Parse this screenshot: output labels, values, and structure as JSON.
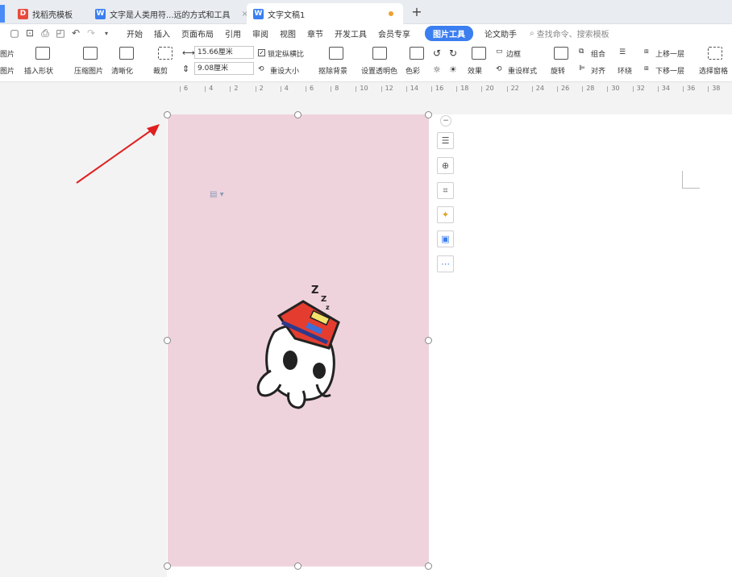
{
  "tabs": [
    {
      "label": "找稻壳模板",
      "color": "#e84a3c"
    },
    {
      "label": "文字是人类用符...远的方式和工具",
      "color": "#3b7ef0",
      "close": "×"
    },
    {
      "label": "文字文稿1",
      "color": "#3b7ef0"
    }
  ],
  "new_tab": "+",
  "menu": {
    "items": [
      "开始",
      "插入",
      "页面布局",
      "引用",
      "审阅",
      "视图",
      "章节",
      "开发工具",
      "会员专享"
    ],
    "active": "图片工具",
    "after": "论文助手",
    "search": "查找命令、搜索模板"
  },
  "ribbon": {
    "img_top": "图片",
    "img_bottom": "图片",
    "insert_shape": "插入形状",
    "compress": "压缩图片",
    "clarify": "清晰化",
    "crop": "裁剪",
    "width": "15.66厘米",
    "height": "9.08厘米",
    "lock_ratio": "锁定纵横比",
    "reset_size": "重设大小",
    "remove_bg": "抠除背景",
    "set_transparent": "设置透明色",
    "color": "色彩",
    "effect": "效果",
    "border": "边框",
    "reset_style": "重设样式",
    "rotate": "旋转",
    "group": "组合",
    "align": "对齐",
    "wrap": "环绕",
    "bring_forward": "上移一层",
    "send_backward": "下移一层",
    "select_pane": "选择窗格"
  },
  "ruler": [
    "6",
    "4",
    "2",
    "2",
    "4",
    "6",
    "8",
    "10",
    "12",
    "14",
    "16",
    "18",
    "20",
    "22",
    "24",
    "26",
    "28",
    "30",
    "32",
    "34",
    "36",
    "38"
  ],
  "sticker_text": "z z z",
  "colors": {
    "image_bg": "#efd3dc",
    "accent": "#3b7ef0",
    "arrow": "#e02020"
  }
}
